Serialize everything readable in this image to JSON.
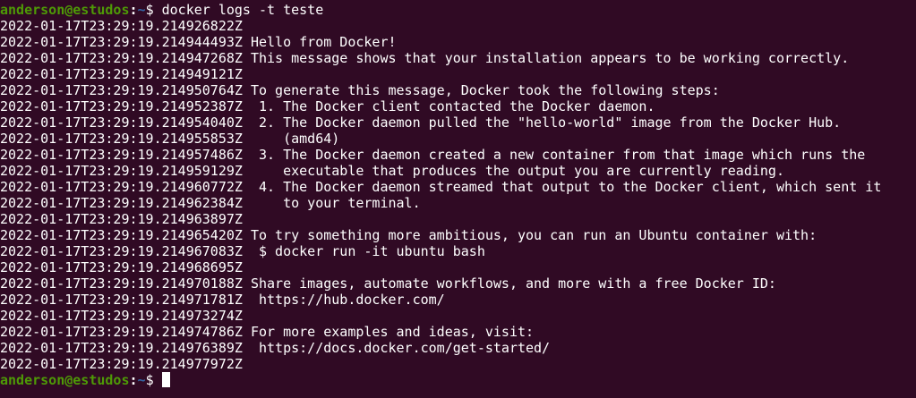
{
  "prompt": {
    "user_host": "anderson@estudos",
    "separator": ":",
    "path": "~",
    "symbol": "$ "
  },
  "command": "docker logs -t teste",
  "log_lines": [
    "2022-01-17T23:29:19.214926822Z",
    "2022-01-17T23:29:19.214944493Z Hello from Docker!",
    "2022-01-17T23:29:19.214947268Z This message shows that your installation appears to be working correctly.",
    "2022-01-17T23:29:19.214949121Z",
    "2022-01-17T23:29:19.214950764Z To generate this message, Docker took the following steps:",
    "2022-01-17T23:29:19.214952387Z  1. The Docker client contacted the Docker daemon.",
    "2022-01-17T23:29:19.214954040Z  2. The Docker daemon pulled the \"hello-world\" image from the Docker Hub.",
    "2022-01-17T23:29:19.214955853Z     (amd64)",
    "2022-01-17T23:29:19.214957486Z  3. The Docker daemon created a new container from that image which runs the",
    "2022-01-17T23:29:19.214959129Z     executable that produces the output you are currently reading.",
    "2022-01-17T23:29:19.214960772Z  4. The Docker daemon streamed that output to the Docker client, which sent it",
    "2022-01-17T23:29:19.214962384Z     to your terminal.",
    "2022-01-17T23:29:19.214963897Z",
    "2022-01-17T23:29:19.214965420Z To try something more ambitious, you can run an Ubuntu container with:",
    "2022-01-17T23:29:19.214967083Z  $ docker run -it ubuntu bash",
    "2022-01-17T23:29:19.214968695Z",
    "2022-01-17T23:29:19.214970188Z Share images, automate workflows, and more with a free Docker ID:",
    "2022-01-17T23:29:19.214971781Z  https://hub.docker.com/",
    "2022-01-17T23:29:19.214973274Z",
    "2022-01-17T23:29:19.214974786Z For more examples and ideas, visit:",
    "2022-01-17T23:29:19.214976389Z  https://docs.docker.com/get-started/",
    "2022-01-17T23:29:19.214977972Z"
  ],
  "colors": {
    "background": "#300a24",
    "foreground": "#ffffff",
    "prompt_user": "#4e9a06",
    "prompt_path": "#3465a4"
  }
}
